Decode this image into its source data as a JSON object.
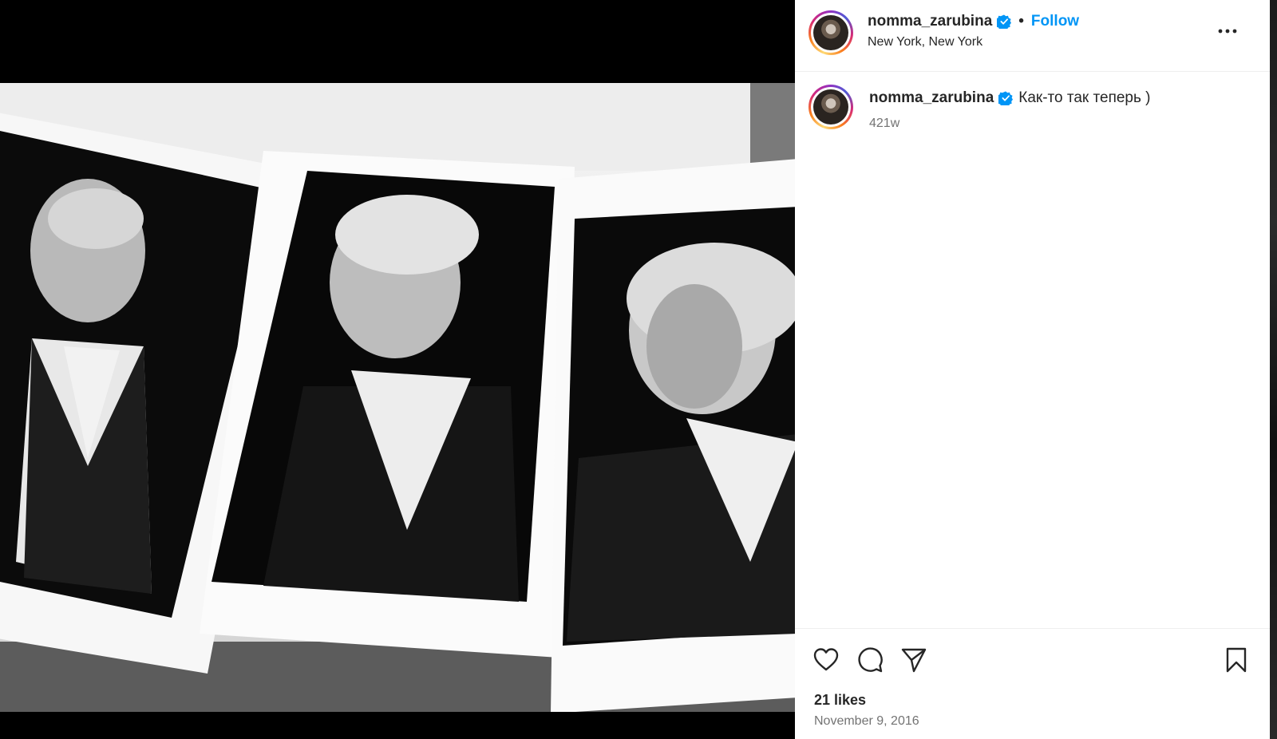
{
  "post": {
    "username": "nomma_zarubina",
    "verified": true,
    "follow_label": "Follow",
    "separator": "•",
    "location": "New York, New York",
    "more_icon": "more-options-icon",
    "caption": {
      "username": "nomma_zarubina",
      "text": "Как-то так теперь )",
      "age": "421w"
    },
    "likes": "21 likes",
    "date": "November 9, 2016",
    "actions": [
      "heart-icon",
      "comment-icon",
      "share-icon",
      "bookmark-icon"
    ]
  },
  "colors": {
    "link_blue": "#0095f6",
    "verified_blue": "#0095f6",
    "text": "#262626",
    "muted": "#737373",
    "divider": "#efefef"
  },
  "media": {
    "description_kind": "black-and-white photo of three printed portraits"
  }
}
